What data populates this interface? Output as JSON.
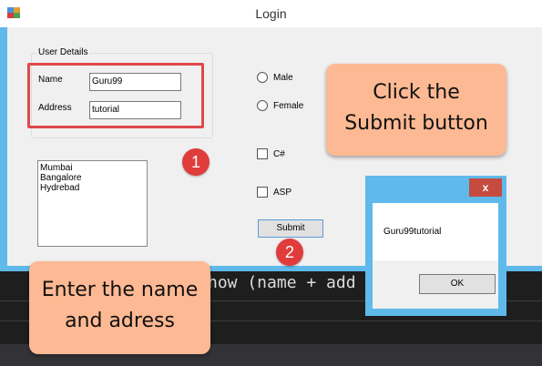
{
  "window": {
    "title": "Login"
  },
  "user_details": {
    "group_title": "User Details",
    "name_label": "Name",
    "name_value": "Guru99",
    "address_label": "Address",
    "address_value": "tutorial"
  },
  "cities": [
    "Mumbai",
    "Bangalore",
    "Hydrebad"
  ],
  "gender": {
    "male_label": "Male",
    "female_label": "Female"
  },
  "courses": {
    "csharp_label": "C#",
    "asp_label": "ASP"
  },
  "submit_label": "Submit",
  "markers": {
    "one": "1",
    "two": "2"
  },
  "callouts": {
    "right_line1": "Click the",
    "right_line2": "Submit button",
    "left_line1": "Enter the name",
    "left_line2": "and adress"
  },
  "message_box": {
    "close_label": "x",
    "message": "Guru99tutorial",
    "ok_label": "OK"
  },
  "code_snippet": "how (name + add",
  "colors": {
    "titlebar_accent": "#5fb9ea",
    "highlight_red": "#e04848",
    "marker_red": "#e03c3c",
    "callout_orange": "#fdb993",
    "close_red": "#c64b3f"
  }
}
